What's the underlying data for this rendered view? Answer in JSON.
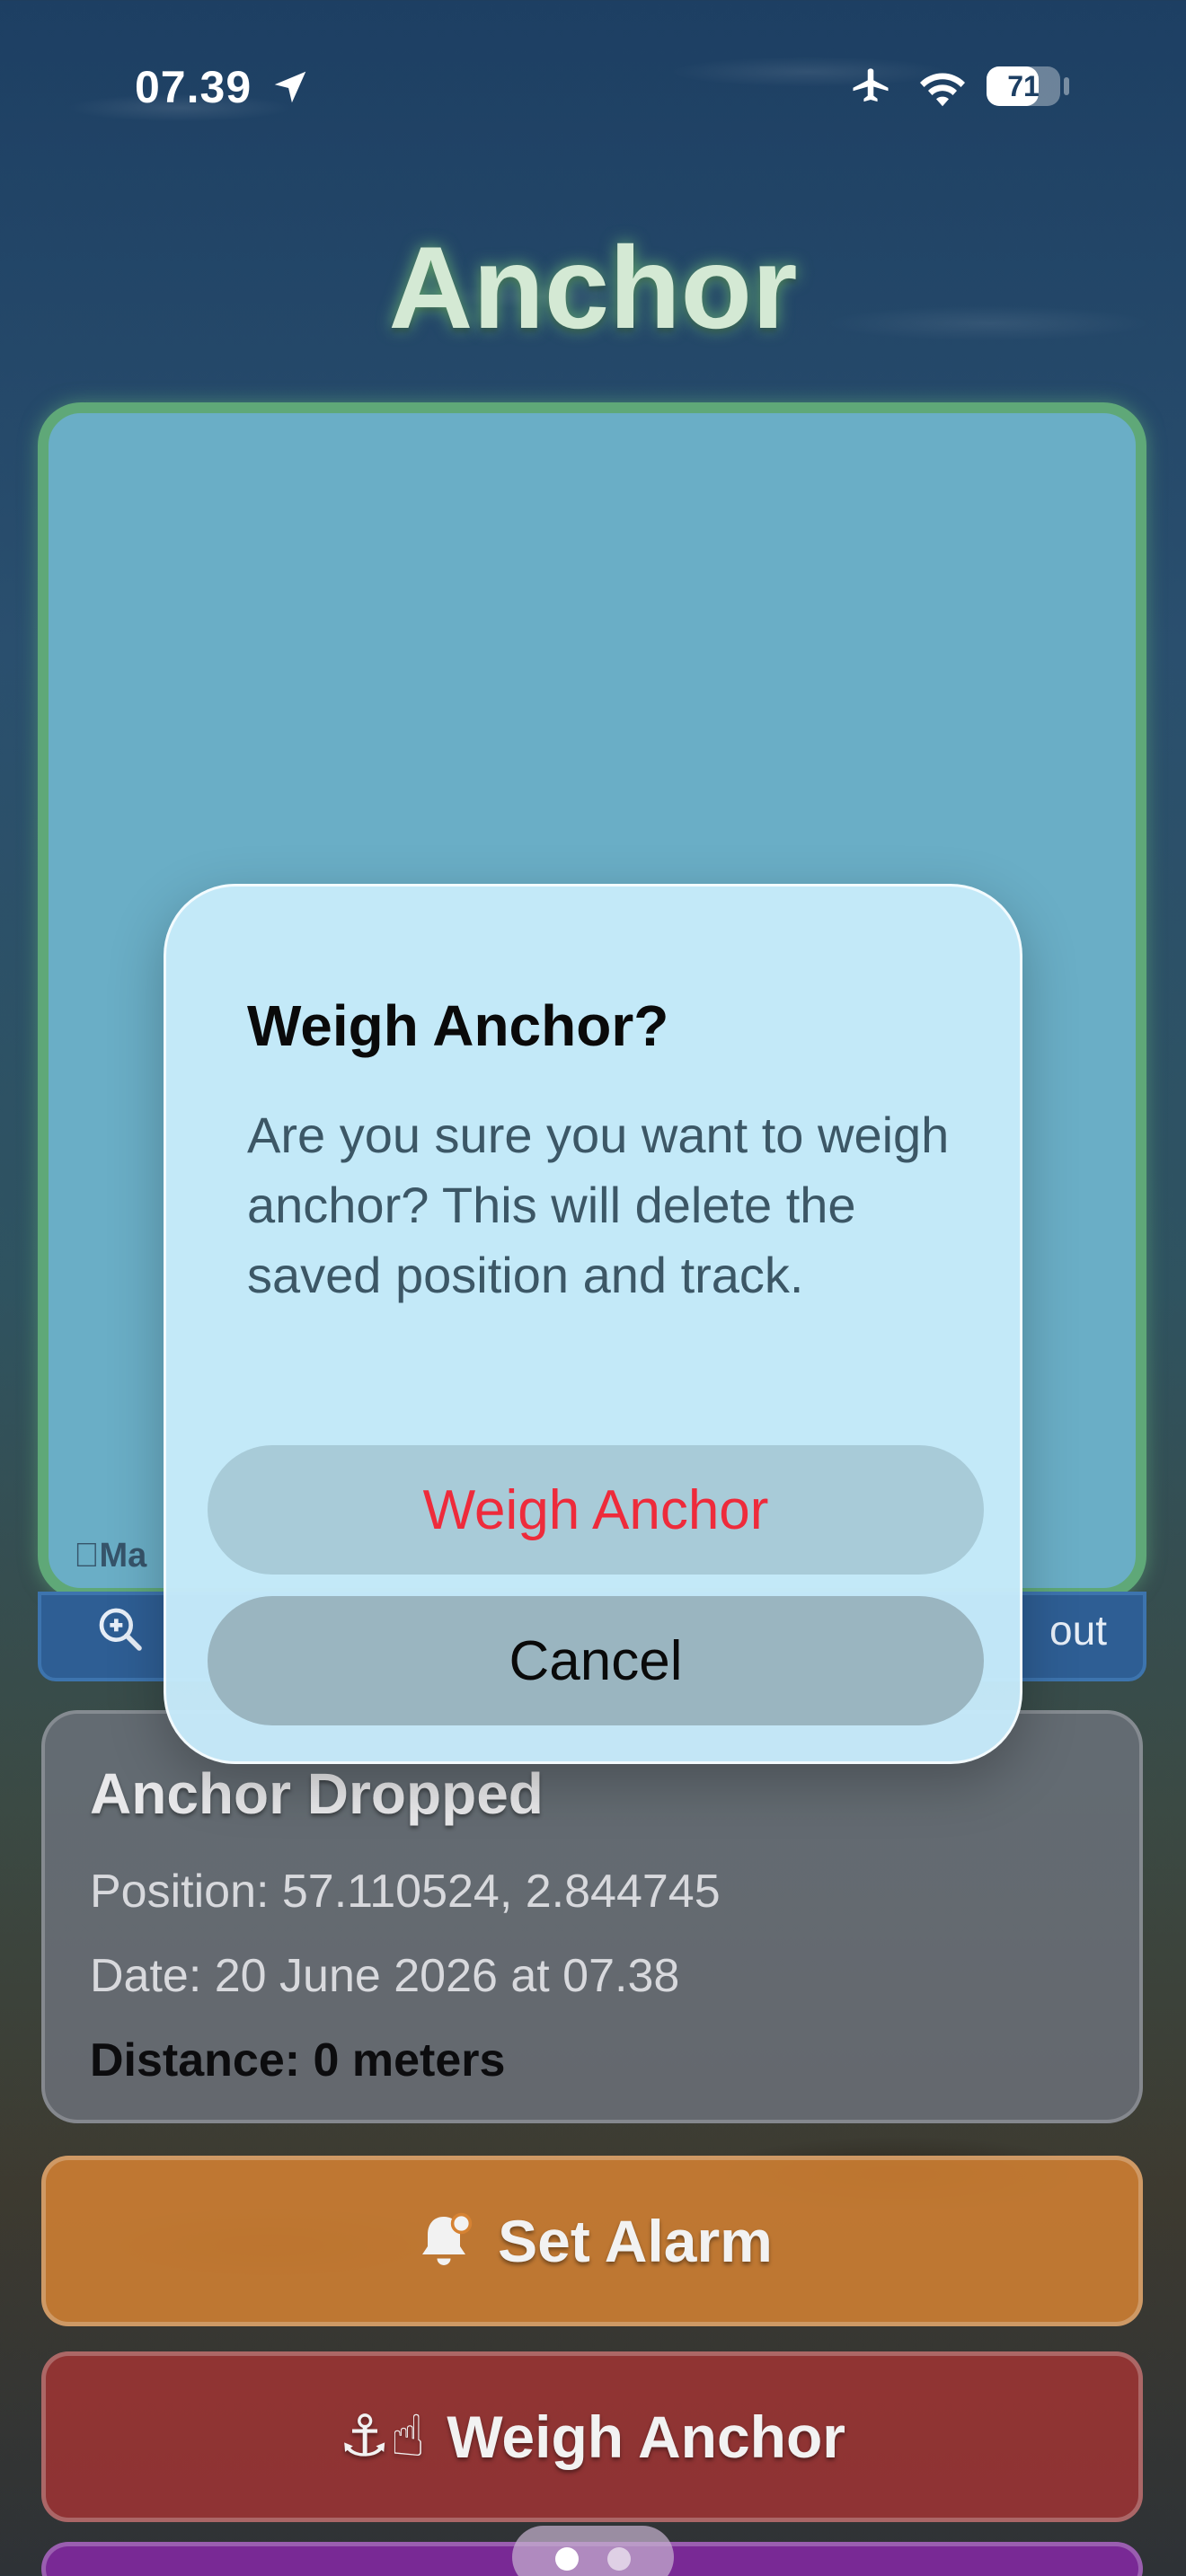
{
  "status_bar": {
    "time": "07.39",
    "battery": "71",
    "battery_level": 0.71,
    "icons": [
      "location-arrow-icon",
      "airplane-icon",
      "wifi-icon",
      "battery-icon"
    ]
  },
  "app": {
    "title": "Anchor"
  },
  "map": {
    "attribution": "Ma",
    "controls": {
      "zoom_out_label": "out"
    }
  },
  "anchor_card": {
    "title": "Anchor Dropped",
    "position": "Position: 57.110524, 2.844745",
    "date": "Date: 20 June 2026 at 07.38",
    "distance": "Distance: 0 meters"
  },
  "buttons": {
    "set_alarm": "Set Alarm",
    "weigh_anchor_emoji": "⚓☝",
    "weigh_anchor": "Weigh Anchor"
  },
  "dialog": {
    "title": "Weigh Anchor?",
    "message": "Are you sure you want to weigh anchor? This will delete the saved position and track.",
    "confirm_label": "Weigh Anchor",
    "cancel_label": "Cancel"
  },
  "colors": {
    "map_border": "#5fa878",
    "alarm_button": "#d68232",
    "weigh_button": "#a03434",
    "destructive_text": "#ee2b3b",
    "dialog_background": "#c6eafa"
  }
}
